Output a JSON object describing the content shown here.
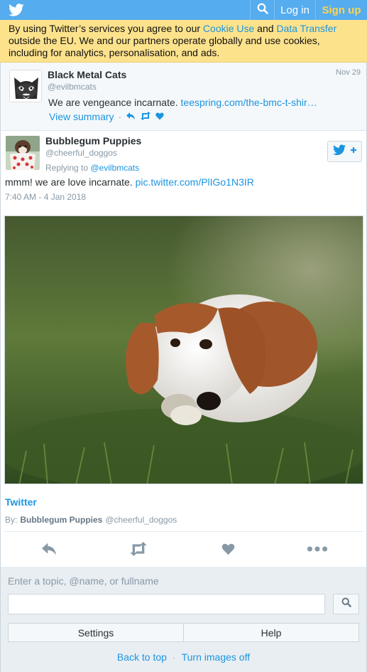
{
  "topbar": {
    "logo_icon": "twitter-bird-icon",
    "search_icon": "search-icon",
    "login_label": "Log in",
    "signup_label": "Sign up",
    "brand_color": "#55acee",
    "signup_color": "#ffd44e"
  },
  "cookie_banner": {
    "text_before": "By using Twitter’s services you agree to our ",
    "cookie_link": "Cookie Use",
    "text_middle": " and ",
    "transfer_link": "Data Transfer",
    "text_after": " outside the EU. We and our partners operate globally and use cookies, including for analytics, personalisation, and ads."
  },
  "parent_tweet": {
    "name": "Black Metal Cats",
    "handle": "@evilbmcats",
    "date": "Nov 29",
    "text": "We are vengeance incarnate. ",
    "link": "teespring.com/the-bmc-t-shir…",
    "view_summary": "View summary",
    "separator": "·",
    "icons": [
      "reply-icon",
      "retweet-icon",
      "heart-icon"
    ]
  },
  "main_tweet": {
    "name": "Bubblegum Puppies",
    "handle": "@cheerful_doggos",
    "replying_prefix": "Replying to ",
    "replying_to": "@evilbmcats",
    "text": "mmm! we are love incarnate. ",
    "link": "pic.twitter.com/PlIGo1N3IR",
    "timestamp": "7:40 AM - 4 Jan 2018",
    "follow_icon": "follow-bird-plus-icon",
    "card_title": "Twitter",
    "by_label": "By:",
    "by_name": "Bubblegum Puppies",
    "by_handle": "@cheerful_doggos",
    "actions": [
      "reply-icon",
      "retweet-icon",
      "heart-icon",
      "more-icon"
    ]
  },
  "footer": {
    "search_label": "Enter a topic, @name, or fullname",
    "search_value": "",
    "search_icon": "search-icon",
    "settings_label": "Settings",
    "help_label": "Help",
    "back_to_top": "Back to top",
    "separator": "·",
    "images_off": "Turn images off"
  }
}
